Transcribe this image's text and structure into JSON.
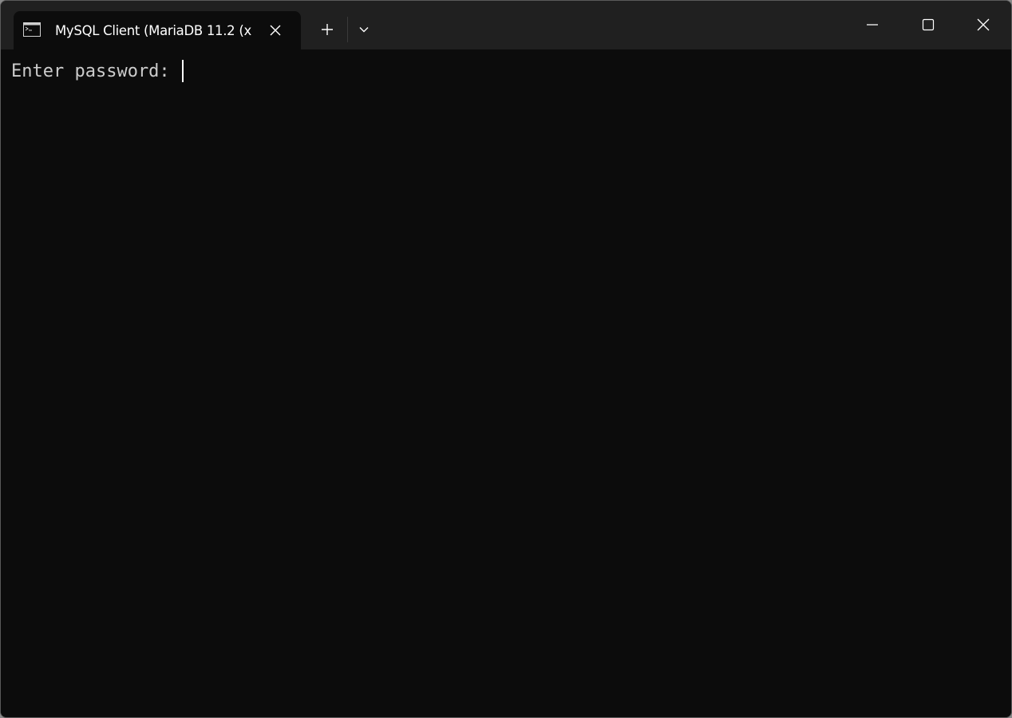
{
  "window": {
    "tab_title": "MySQL Client (MariaDB 11.2 (x",
    "tab_icon": "terminal-icon",
    "close_tab_icon": "close-icon",
    "new_tab_icon": "plus-icon",
    "dropdown_icon": "chevron-down-icon",
    "minimize_icon": "minimize-icon",
    "maximize_icon": "maximize-icon",
    "close_window_icon": "close-icon"
  },
  "terminal": {
    "prompt": "Enter password: ",
    "input_value": ""
  },
  "colors": {
    "terminal_background": "#0c0c0c",
    "titlebar_background": "#202020",
    "text": "#cccccc",
    "cursor": "#ffffff"
  }
}
